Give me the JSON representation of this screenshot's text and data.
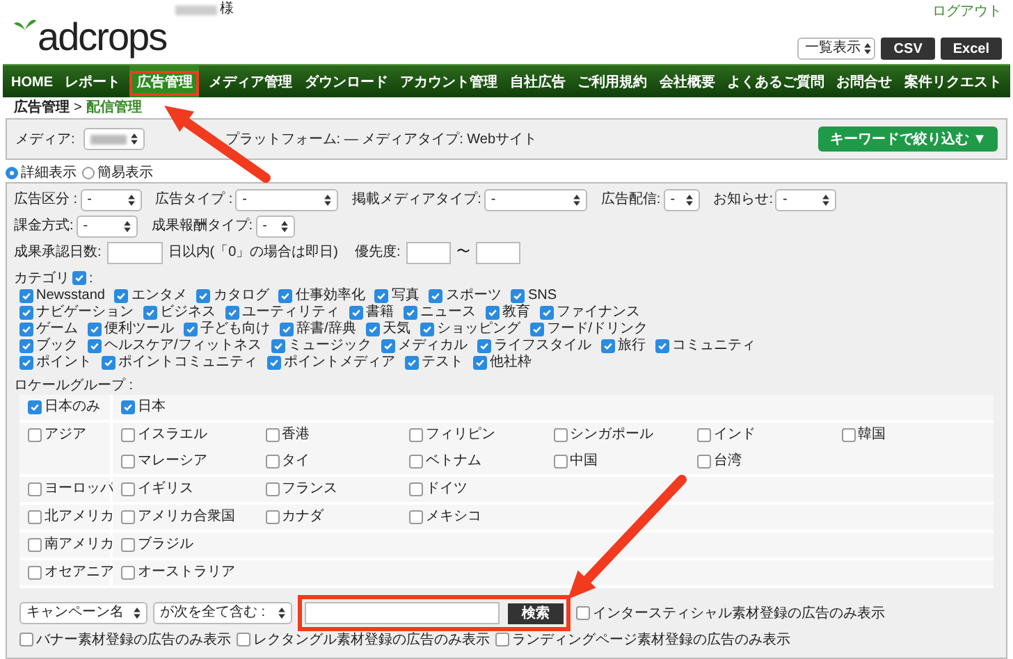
{
  "header": {
    "user_suffix": "様",
    "logout": "ログアウト",
    "logo": "adcrops",
    "view_select": "一覧表示",
    "export_buttons": [
      "CSV",
      "Excel"
    ]
  },
  "nav": [
    {
      "label": "HOME",
      "selected": false
    },
    {
      "label": "レポート",
      "selected": false
    },
    {
      "label": "広告管理",
      "selected": true,
      "highlighted": true
    },
    {
      "label": "メディア管理",
      "selected": false
    },
    {
      "label": "ダウンロード",
      "selected": false
    },
    {
      "label": "アカウント管理",
      "selected": false
    },
    {
      "label": "自社広告",
      "selected": false
    },
    {
      "label": "ご利用規約",
      "selected": false
    },
    {
      "label": "会社概要",
      "selected": false
    },
    {
      "label": "よくあるご質問",
      "selected": false
    },
    {
      "label": "お問合せ",
      "selected": false
    },
    {
      "label": "案件リクエスト",
      "selected": false
    }
  ],
  "breadcrumb": [
    {
      "label": "広告管理"
    },
    {
      "label": "配信管理"
    }
  ],
  "breadcrumb_separator": ">",
  "media": {
    "label": "メディア:",
    "platform": "プラットフォーム: — メディアタイプ: Webサイト",
    "keyword_button": "キーワードで絞り込む ▼"
  },
  "display_modes": [
    {
      "label": "詳細表示",
      "selected": true
    },
    {
      "label": "簡易表示",
      "selected": false
    }
  ],
  "filter_rows": [
    [
      {
        "label": "広告区分 :",
        "value": "-"
      },
      {
        "label": "広告タイプ :",
        "value": "-"
      },
      {
        "label": "掲載メディアタイプ:",
        "value": "-"
      },
      {
        "label": "広告配信:",
        "value": "-"
      },
      {
        "label": "お知らせ:",
        "value": "-"
      }
    ],
    [
      {
        "label": "課金方式:",
        "value": "-"
      },
      {
        "label": "成果報酬タイプ:",
        "value": "-"
      }
    ]
  ],
  "approval": {
    "label": "成果承認日数:",
    "note": "日以内(「0」の場合は即日)",
    "priority_label": "優先度:",
    "range_separator": "〜"
  },
  "categories": {
    "label": "カテゴリ",
    "all_checked": true,
    "suffix": ":",
    "lines": [
      [
        {
          "label": "Newsstand",
          "checked": true
        },
        {
          "label": "エンタメ",
          "checked": true
        },
        {
          "label": "カタログ",
          "checked": true
        },
        {
          "label": "仕事効率化",
          "checked": true
        },
        {
          "label": "写真",
          "checked": true
        },
        {
          "label": "スポーツ",
          "checked": true
        },
        {
          "label": "SNS",
          "checked": true
        }
      ],
      [
        {
          "label": "ナビゲーション",
          "checked": true
        },
        {
          "label": "ビジネス",
          "checked": true
        },
        {
          "label": "ユーティリティ",
          "checked": true
        },
        {
          "label": "書籍",
          "checked": true
        },
        {
          "label": "ニュース",
          "checked": true
        },
        {
          "label": "教育",
          "checked": true
        },
        {
          "label": "ファイナンス",
          "checked": true
        }
      ],
      [
        {
          "label": "ゲーム",
          "checked": true
        },
        {
          "label": "便利ツール",
          "checked": true
        },
        {
          "label": "子ども向け",
          "checked": true
        },
        {
          "label": "辞書/辞典",
          "checked": true
        },
        {
          "label": "天気",
          "checked": true
        },
        {
          "label": "ショッピング",
          "checked": true
        },
        {
          "label": "フード/ドリンク",
          "checked": true
        }
      ],
      [
        {
          "label": "ブック",
          "checked": true
        },
        {
          "label": "ヘルスケア/フィットネス",
          "checked": true
        },
        {
          "label": "ミュージック",
          "checked": true
        },
        {
          "label": "メディカル",
          "checked": true
        },
        {
          "label": "ライフスタイル",
          "checked": true
        },
        {
          "label": "旅行",
          "checked": true
        },
        {
          "label": "コミュニティ",
          "checked": true
        }
      ],
      [
        {
          "label": "ポイント",
          "checked": true
        },
        {
          "label": "ポイントコミュニティ",
          "checked": true
        },
        {
          "label": "ポイントメディア",
          "checked": true
        },
        {
          "label": "テスト",
          "checked": true
        },
        {
          "label": "他社枠",
          "checked": true
        }
      ]
    ]
  },
  "locale": {
    "label": "ロケールグループ :",
    "groups": [
      {
        "label": "日本のみ",
        "checked": true,
        "countries": [
          {
            "label": "日本",
            "checked": true
          }
        ]
      },
      {
        "label": "アジア",
        "checked": false,
        "countries": [
          {
            "label": "イスラエル",
            "checked": false
          },
          {
            "label": "香港",
            "checked": false
          },
          {
            "label": "フィリピン",
            "checked": false
          },
          {
            "label": "シンガポール",
            "checked": false
          },
          {
            "label": "インド",
            "checked": false
          },
          {
            "label": "韓国",
            "checked": false
          },
          {
            "label": "マレーシア",
            "checked": false
          },
          {
            "label": "タイ",
            "checked": false
          },
          {
            "label": "ベトナム",
            "checked": false
          },
          {
            "label": "中国",
            "checked": false
          },
          {
            "label": "台湾",
            "checked": false
          }
        ]
      },
      {
        "label": "ヨーロッパ",
        "checked": false,
        "countries": [
          {
            "label": "イギリス",
            "checked": false
          },
          {
            "label": "フランス",
            "checked": false
          },
          {
            "label": "ドイツ",
            "checked": false
          }
        ]
      },
      {
        "label": "北アメリカ",
        "checked": false,
        "countries": [
          {
            "label": "アメリカ合衆国",
            "checked": false
          },
          {
            "label": "カナダ",
            "checked": false
          },
          {
            "label": "メキシコ",
            "checked": false
          }
        ]
      },
      {
        "label": "南アメリカ",
        "checked": false,
        "countries": [
          {
            "label": "ブラジル",
            "checked": false
          }
        ]
      },
      {
        "label": "オセアニア",
        "checked": false,
        "countries": [
          {
            "label": "オーストラリア",
            "checked": false
          }
        ]
      }
    ]
  },
  "search": {
    "highlighted": true,
    "field_select": "キャンペーン名",
    "condition_select": "が次を全て含む :",
    "button": "検索",
    "options": [
      {
        "label": "インタースティシャル素材登録の広告のみ表示",
        "checked": false
      },
      {
        "label": "バナー素材登録の広告のみ表示",
        "checked": false
      },
      {
        "label": "レクタングル素材登録の広告のみ表示",
        "checked": false
      },
      {
        "label": "ランディングページ素材登録の広告のみ表示",
        "checked": false
      }
    ]
  }
}
